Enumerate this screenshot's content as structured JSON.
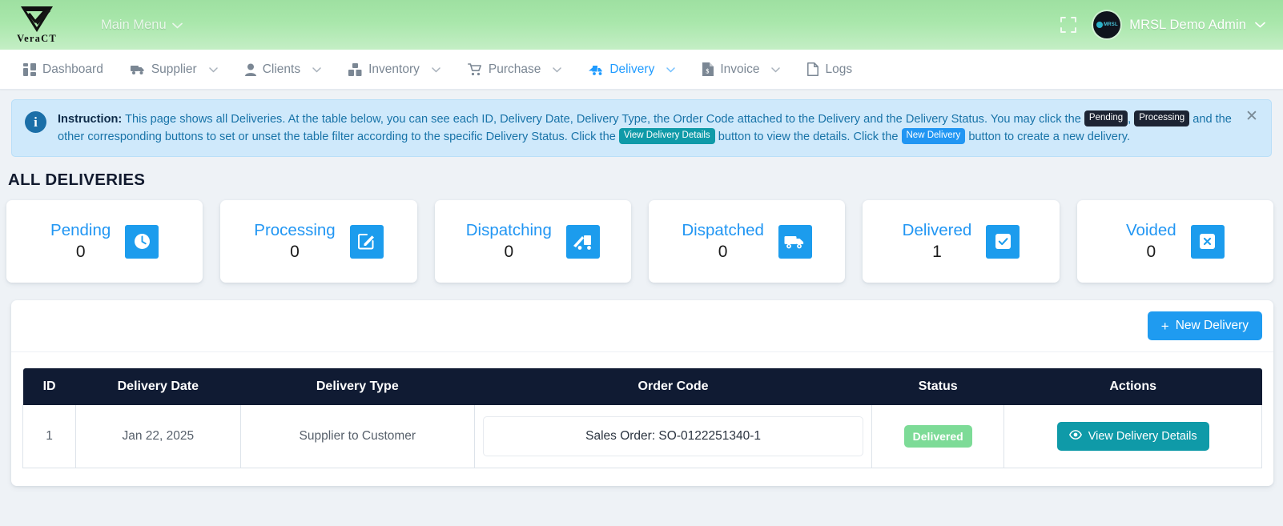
{
  "header": {
    "brand_name": "VeraCT",
    "brand_logo_icon": "veract-v-check-arrow-logo",
    "main_menu_label": "Main Menu",
    "main_menu_caret_icon": "chevron-down-icon",
    "expand_icon": "fullscreen-expand-icon",
    "avatar_icon": "mrsl-avatar-logo",
    "avatar_text": "MRSL",
    "username": "MRSL Demo Admin",
    "user_caret_icon": "chevron-down-icon",
    "colors": {
      "header_gradient_top": "#9ee0a1",
      "header_gradient_bottom": "#c4eec5"
    }
  },
  "nav": {
    "items": [
      {
        "label": "Dashboard",
        "icon": "dashboard-grid-icon",
        "has_caret": false,
        "active": false
      },
      {
        "label": "Supplier",
        "icon": "truck-icon",
        "has_caret": true,
        "active": false
      },
      {
        "label": "Clients",
        "icon": "person-icon",
        "has_caret": true,
        "active": false
      },
      {
        "label": "Inventory",
        "icon": "boxes-icon",
        "has_caret": true,
        "active": false
      },
      {
        "label": "Purchase",
        "icon": "shopping-cart-icon",
        "has_caret": true,
        "active": false
      },
      {
        "label": "Delivery",
        "icon": "delivery-van-icon",
        "has_caret": true,
        "active": true
      },
      {
        "label": "Invoice",
        "icon": "invoice-document-icon",
        "has_caret": true,
        "active": false
      },
      {
        "label": "Logs",
        "icon": "file-log-icon",
        "has_caret": false,
        "active": false
      }
    ],
    "active_color": "#1f9bff"
  },
  "instruction": {
    "info_icon": "info-circle-icon",
    "close_icon": "close-icon",
    "label": "Instruction:",
    "seg1": "This page shows all Deliveries. At the table below, you can see each ID, Delivery Date, Delivery Type, the Order Code attached to the Delivery and the Delivery Status. You may click the",
    "chip_pending": "Pending",
    "comma": ",",
    "chip_processing": "Processing",
    "seg2": "and the other corresponding buttons to set or unset the table filter according to the specific Delivery Status. Click the",
    "chip_view": "View Delivery Details",
    "seg3": "button to view the details. Click the",
    "chip_new": "New Delivery",
    "seg4": "button to create a new delivery."
  },
  "page_title": "ALL DELIVERIES",
  "status_cards": [
    {
      "label": "Pending",
      "count": "0",
      "icon": "clock-icon"
    },
    {
      "label": "Processing",
      "count": "0",
      "icon": "edit-square-icon"
    },
    {
      "label": "Dispatching",
      "count": "0",
      "icon": "loading-truck-icon"
    },
    {
      "label": "Dispatched",
      "count": "0",
      "icon": "truck-side-icon"
    },
    {
      "label": "Delivered",
      "count": "1",
      "icon": "checkbox-check-icon"
    },
    {
      "label": "Voided",
      "count": "0",
      "icon": "x-square-icon"
    }
  ],
  "toolbar": {
    "new_delivery_label": "New Delivery",
    "plus_icon": "plus-icon"
  },
  "table": {
    "columns": [
      "ID",
      "Delivery Date",
      "Delivery Type",
      "Order Code",
      "Status",
      "Actions"
    ],
    "rows": [
      {
        "id": "1",
        "delivery_date": "Jan 22, 2025",
        "delivery_type": "Supplier to Customer",
        "order_code": "Sales Order: SO-0122251340-1",
        "status": "Delivered",
        "action_label": "View Delivery Details",
        "action_icon": "eye-icon"
      }
    ]
  },
  "colors": {
    "accent_blue": "#1f9bf0",
    "card_icon_blue": "#1c9ced",
    "table_header_navy": "#101b33",
    "delivered_green": "#7ddb97",
    "view_teal": "#0f9aa8",
    "banner_blue": "#cfe9fb",
    "page_bg": "#eef2f6"
  }
}
